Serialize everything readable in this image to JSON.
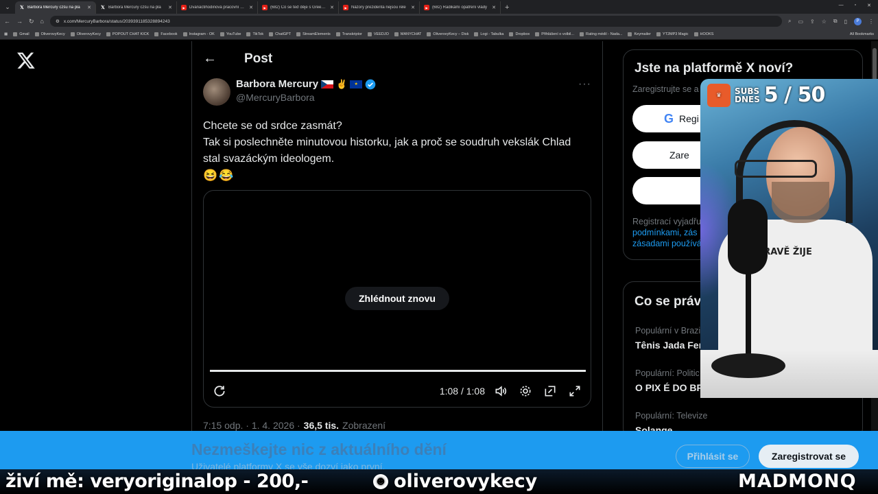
{
  "browser": {
    "tabs": [
      {
        "title": "Barbora Mercury czšu na pla",
        "icon": "x-icon",
        "active": true
      },
      {
        "title": "Barbora Mercury czšu na pla",
        "icon": "x-icon",
        "active": false
      },
      {
        "title": "Dvanáctihodinová pracovní dob",
        "icon": "youtube-icon",
        "active": false
      },
      {
        "title": "(682) Co se teď děje s Green D",
        "icon": "youtube-icon",
        "active": false
      },
      {
        "title": "Názory prezidenta nejsou rele",
        "icon": "youtube-icon",
        "active": false
      },
      {
        "title": "(682) Radikální opatření vlády",
        "icon": "youtube-icon",
        "active": false
      }
    ],
    "new_tab": "+",
    "url": "x.com/MercuryBarbora/status/2039391185328894243",
    "bookmarks": [
      "Gmail",
      "OliverovyKecy",
      "OliverovyKecy",
      "POPOUT CHAT KICK",
      "Facebook",
      "Instagram - OK",
      "YouTube",
      "TikTok",
      "ChatGPT",
      "StreamElements",
      "Transkriptor",
      "VEEDJO",
      "MANYCHAT",
      "OliverovyKecy – Disk",
      "Logi - Tabulka",
      "Dropbox",
      "Přihlášení o volbil...",
      "Rating médií - Nada...",
      "Keymailer",
      "YT2MP3 Magic",
      "HOOKS"
    ],
    "all_bookmarks": "All Bookmarks",
    "profile_initial": "P"
  },
  "post": {
    "header_title": "Post",
    "author_name": "Barbora Mercury",
    "author_handle": "@MercuryBarbora",
    "text_lines": [
      "Chcete se od srdce zasmát?",
      "Tak si poslechněte minutovou historku, jak a proč se soudruh vekslák Chlad",
      "stal svazáckým ideologem."
    ],
    "emojis": "😆😂",
    "video": {
      "replay_label": "Zhlédnout znovu",
      "time": "1:08 / 1:08",
      "progress": 1.0
    },
    "meta": {
      "time": "7:15 odp. · 1. 4. 2026 ·",
      "views_count": "36,5 tis.",
      "views_label": "Zobrazení"
    }
  },
  "sidebar": {
    "signup": {
      "title": "Jste na platformě X noví?",
      "subtitle": "Zaregistrujte se a",
      "google_label": "Regi",
      "apple_label": "Zare",
      "legal_prefix": "Registrací vyjadřu",
      "legal_link1": "podmínkami, zás",
      "legal_link2": "zásadami používá"
    },
    "trends": {
      "title": "Co se práv",
      "items": [
        {
          "category": "Populární v Brazi",
          "name": "Tênis Jada Fer"
        },
        {
          "category": "Populární: Politic",
          "name": "O PIX É DO BR"
        },
        {
          "category": "Populární: Televize",
          "name": "Solange"
        }
      ]
    }
  },
  "banner": {
    "title": "Nezmeškejte nic z aktuálního dění",
    "subtitle": "Uživatelé platformy X se vše dozví jako první.",
    "login_label": "Přihlásit se",
    "register_label": "Zaregistrovat se"
  },
  "stream_overlay": {
    "left_text": "živí mě: veryoriginalop - 200,-",
    "middle_text": "oliverovykecy",
    "right_text": "MADMONQ",
    "subs_label_1": "SUBS",
    "subs_label_2": "DNES",
    "subs_count": "5 / 50",
    "shirt_text": "ZDRAVĚ ŽIJE"
  },
  "colors": {
    "accent": "#1d9bf0",
    "background": "#000000",
    "border": "#2f3336",
    "muted": "#71767b"
  }
}
